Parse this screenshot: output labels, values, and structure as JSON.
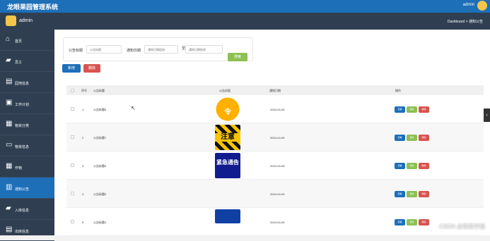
{
  "header": {
    "app_title": "龙眼果园管理系统",
    "user": "admin"
  },
  "subheader": {
    "admin_name": "admin",
    "breadcrumb": "Dashboard > 通知公告"
  },
  "sidebar": {
    "items": [
      {
        "label": "首页",
        "icon": "home-icon"
      },
      {
        "label": "员工",
        "icon": "briefcase-icon"
      },
      {
        "label": "园地信息",
        "icon": "list-icon"
      },
      {
        "label": "工作计划",
        "icon": "file-icon"
      },
      {
        "label": "物资分类",
        "icon": "storage-icon"
      },
      {
        "label": "物资信息",
        "icon": "chat-icon"
      },
      {
        "label": "作物",
        "icon": "grid-icon"
      },
      {
        "label": "通知公告",
        "icon": "bar-chart-icon",
        "active": true
      },
      {
        "label": "入库信息",
        "icon": "inbox-icon"
      },
      {
        "label": "出库信息",
        "icon": "list-icon"
      }
    ]
  },
  "search": {
    "title_label": "公告标题",
    "title_placeholder": "公告标题",
    "date_label": "通知日期",
    "start_placeholder": "通知日期起始",
    "separator": "至",
    "end_placeholder": "通知日期结束",
    "search_button": "搜索"
  },
  "toolbar": {
    "add_button": "新增",
    "delete_button": "删除"
  },
  "table": {
    "headers": [
      "序号",
      "公告标题",
      "公告封面",
      "通知日期",
      "操作"
    ],
    "rows": [
      {
        "index": "1",
        "title": "公告标题8",
        "date": "2024-04-05",
        "image_text": "令"
      },
      {
        "index": "2",
        "title": "公告标题7",
        "date": "2024-04-05",
        "image_text": "注意"
      },
      {
        "index": "3",
        "title": "公告标题6",
        "date": "2024-04-05",
        "image_text": "紧急通告"
      },
      {
        "index": "4",
        "title": "公告标题5",
        "date": "2024-04-05",
        "image_text": ""
      },
      {
        "index": "5",
        "title": "公告标题4",
        "date": "2024-04-05",
        "image_text": ""
      }
    ],
    "actions": {
      "view": "查看",
      "edit": "修改",
      "delete": "删除"
    }
  },
  "watermark": "CSDN @茹茹学姐",
  "colors": {
    "primary": "#1d6fb8",
    "sidebar": "#2f3f51",
    "success": "#8cc152",
    "danger": "#d9534f"
  }
}
